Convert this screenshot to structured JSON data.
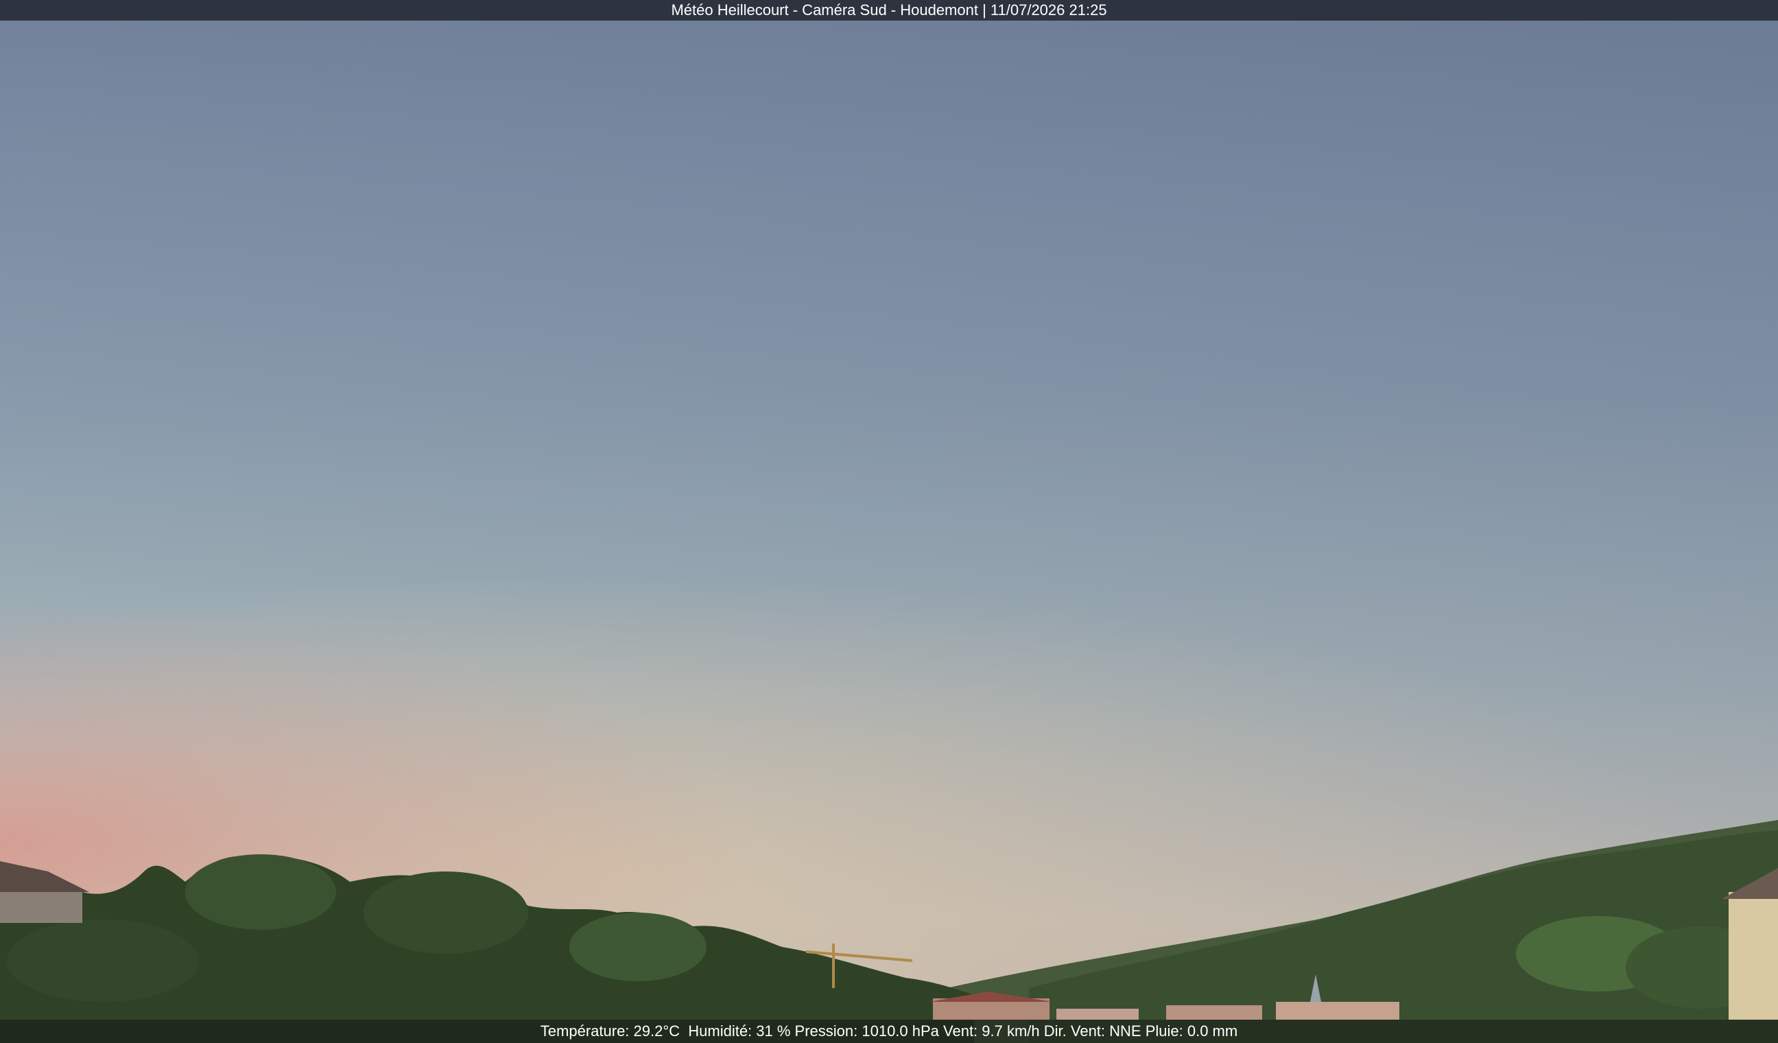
{
  "overlay": {
    "title": "Météo Heillecourt - Caméra Sud - Houdemont | 11/07/2026 21:25",
    "weather_line": "Température: 29.2°C  Humidité: 31 % Pression: 1010.0 hPa Vent: 9.7 km/h Dir. Vent: NNE Pluie: 0.0 mm"
  },
  "colors": {
    "sky_top": "#6f7f98",
    "sky_horizon": "#d6c2b2",
    "sunset_glow": "#d6968c",
    "hills": "#3e5230",
    "trees": "#2f4226",
    "overlay_bg": "#282c38",
    "overlay_text": "#ffffff"
  }
}
